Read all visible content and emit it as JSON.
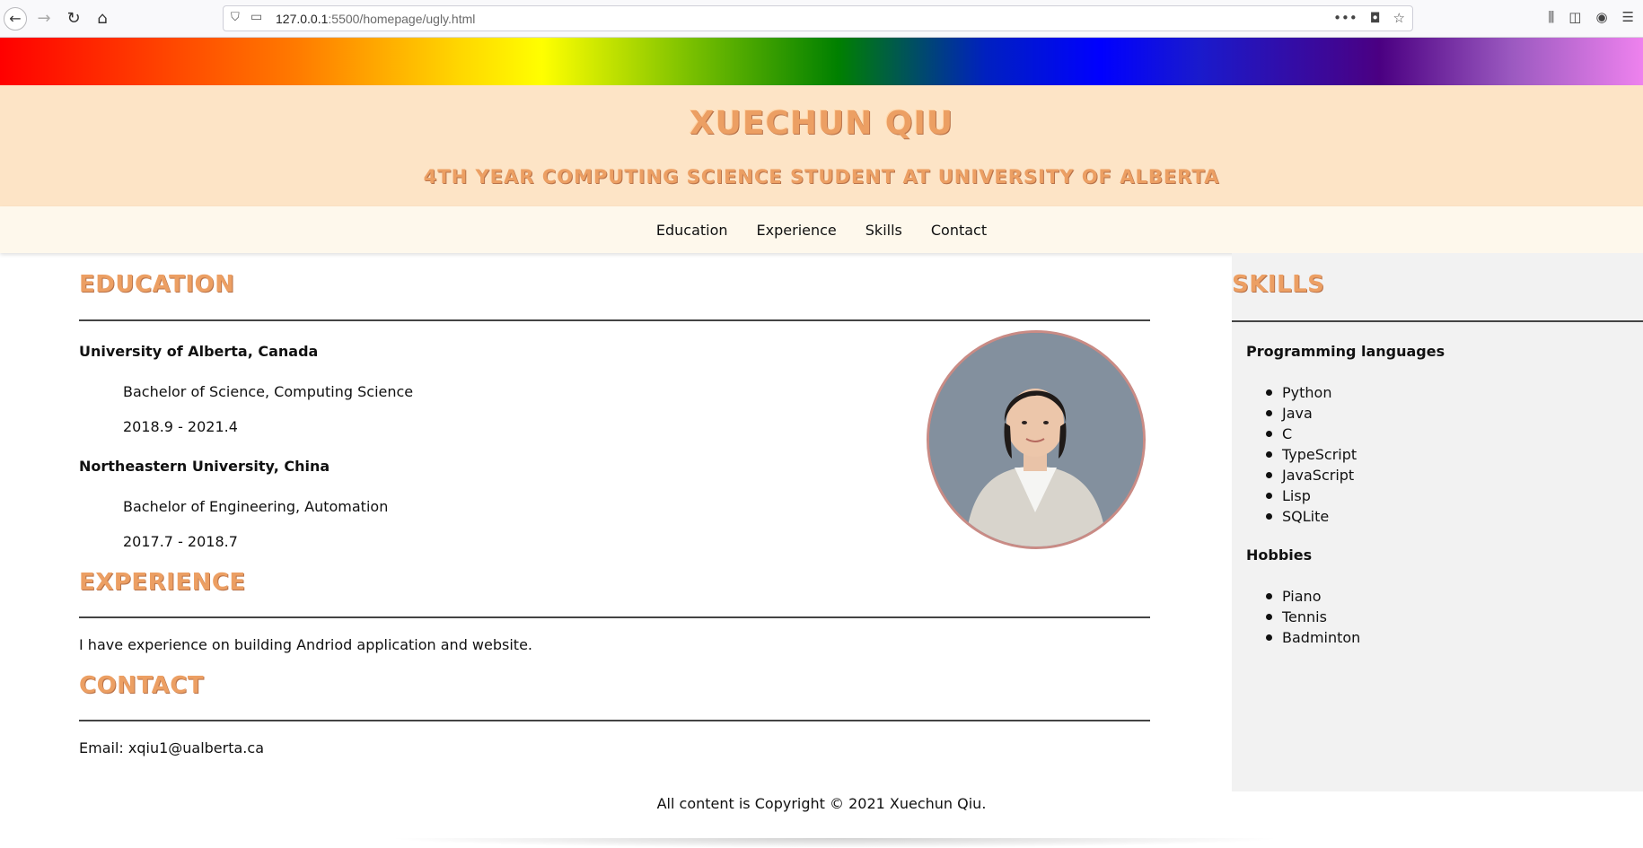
{
  "browser": {
    "url_host": "127.0.0.1",
    "url_rest": ":5500/homepage/ugly.html",
    "icons": [
      "back-arrow-icon",
      "forward-arrow-icon",
      "reload-icon",
      "home-icon",
      "shield-icon",
      "page-icon",
      "more-icon",
      "pocket-icon",
      "bookmark-star-icon",
      "library-icon",
      "sidebar-icon",
      "account-icon",
      "menu-icon"
    ]
  },
  "header": {
    "title": "XUECHUN QIU",
    "subtitle": "4TH YEAR COMPUTING SCIENCE STUDENT AT UNIVERSITY OF ALBERTA"
  },
  "nav": {
    "items": [
      "Education",
      "Experience",
      "Skills",
      "Contact"
    ]
  },
  "education": {
    "heading": "EDUCATION",
    "schools": [
      {
        "name": "University of Alberta, Canada",
        "degree": "Bachelor of Science, Computing Science",
        "dates": "2018.9 - 2021.4"
      },
      {
        "name": "Northeastern University, China",
        "degree": "Bachelor of Engineering, Automation",
        "dates": "2017.7 - 2018.7"
      }
    ]
  },
  "experience": {
    "heading": "EXPERIENCE",
    "text": "I have experience on building Andriod application and website."
  },
  "contact": {
    "heading": "CONTACT",
    "text": "Email: xqiu1@ualberta.ca"
  },
  "skills": {
    "heading": "SKILLS",
    "languages_label": "Programming languages",
    "languages": [
      "Python",
      "Java",
      "C",
      "TypeScript",
      "JavaScript",
      "Lisp",
      "SQLite"
    ],
    "hobbies_label": "Hobbies",
    "hobbies": [
      "Piano",
      "Tennis",
      "Badminton"
    ]
  },
  "footer": {
    "text": "All content is Copyright © 2021 Xuechun Qiu."
  },
  "colors": {
    "header_bg": "#fde4c6",
    "heading_orange": "#ec9f63",
    "nav_bg": "#fef8ec",
    "sidebar_bg": "#f2f2f2",
    "photo_border": "#c98b85"
  }
}
